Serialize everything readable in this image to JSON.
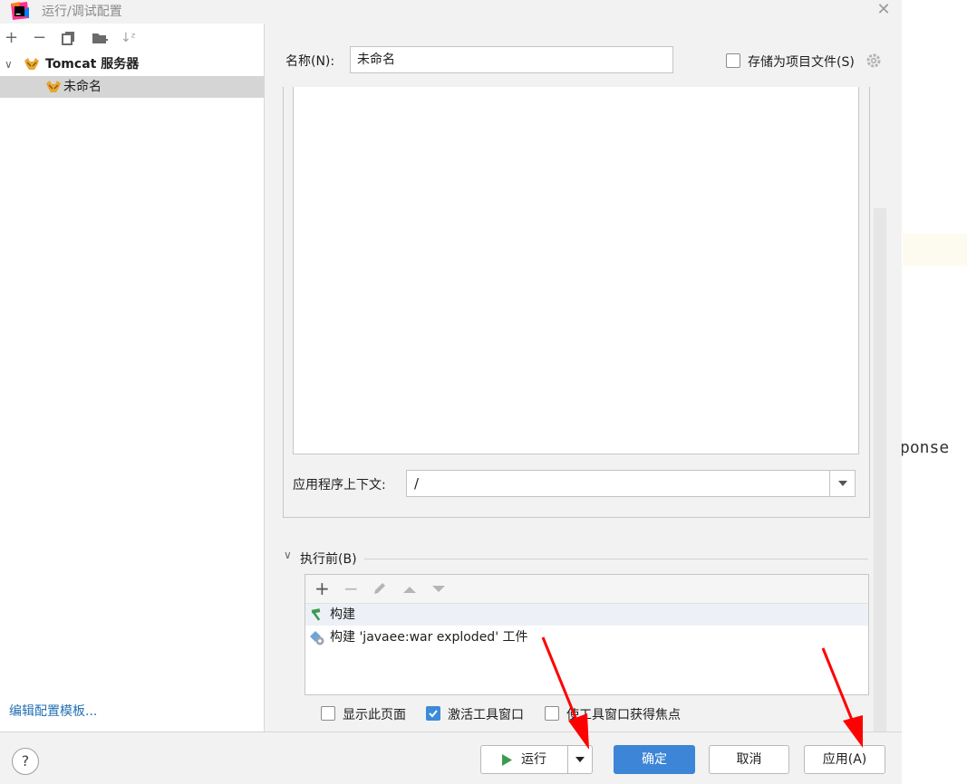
{
  "window": {
    "title": "运行/调试配置",
    "close_symbol": "✕"
  },
  "left_toolbar": {
    "icons": [
      "add-icon",
      "remove-icon",
      "copy-icon",
      "new-folder-icon",
      "sort-icon"
    ],
    "glyphs": {
      "add": "+",
      "remove": "−",
      "sort": "↓ᶻ"
    }
  },
  "tree": {
    "group": {
      "label": "Tomcat 服务器",
      "expand_glyph": "∨"
    },
    "selected_item": {
      "label": "未命名"
    }
  },
  "edit_templates_link": "编辑配置模板...",
  "form": {
    "name_label": "名称(N):",
    "name_value": "未命名",
    "store_as_project_file_label": "存储为项目文件(S)",
    "store_as_project_file_checked": false,
    "app_context_label": "应用程序上下文:",
    "app_context_value": "/"
  },
  "before_launch": {
    "section_label": "执行前(B)",
    "toolbar_icons": [
      "add-icon",
      "remove-icon",
      "edit-icon",
      "move-up-icon",
      "move-down-icon"
    ],
    "tasks": [
      {
        "label": "构建",
        "icon": "hammer-icon"
      },
      {
        "label": "构建 'javaee:war exploded' 工件",
        "icon": "artifact-icon"
      }
    ]
  },
  "options": {
    "show_page": {
      "label": "显示此页面",
      "checked": false
    },
    "activate_tool_window": {
      "label": "激活工具窗口",
      "checked": true
    },
    "focus_tool_window": {
      "label": "使工具窗口获得焦点",
      "checked": false
    }
  },
  "buttons": {
    "help": "?",
    "run": "运行",
    "ok": "确定",
    "cancel": "取消",
    "apply": "应用(A)"
  },
  "background_editor_text": "ponse",
  "colors": {
    "primary_button": "#3d85d6",
    "link": "#2470b3",
    "annotation_arrow": "#ff0000",
    "selection": "#d5d5d5"
  }
}
